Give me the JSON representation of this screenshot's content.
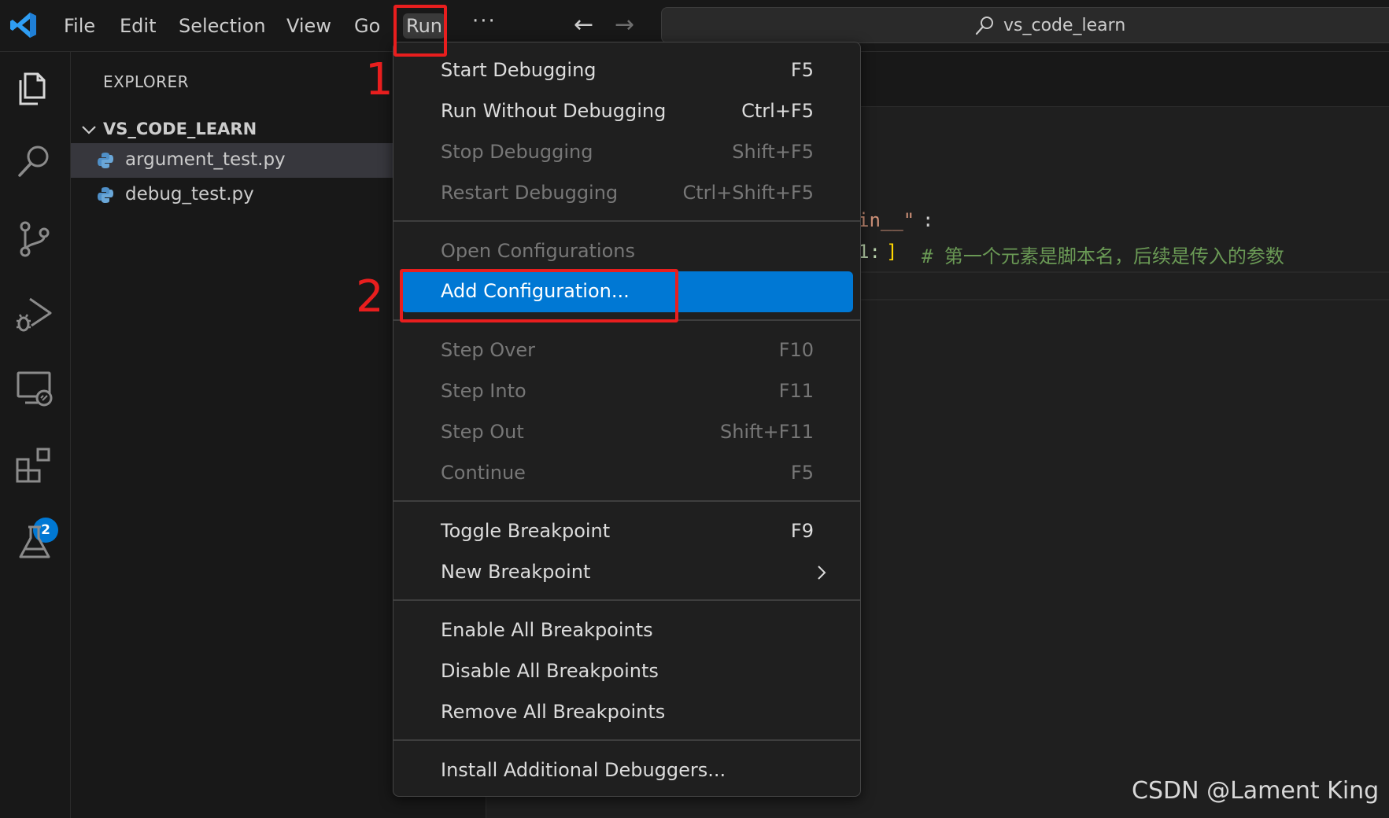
{
  "menubar": {
    "items": [
      "File",
      "Edit",
      "Selection",
      "View",
      "Go",
      "Run"
    ],
    "more": "···",
    "back_arrow": "←",
    "forward_arrow": "→"
  },
  "search": {
    "text": "vs_code_learn",
    "icon": "search-icon"
  },
  "activity_bar": {
    "icons": [
      "explorer-icon",
      "search-icon",
      "source-control-icon",
      "run-debug-icon",
      "remote-explorer-icon",
      "extensions-icon",
      "testing-icon"
    ],
    "extensions_badge": "2"
  },
  "sidebar": {
    "title": "EXPLORER",
    "folder": "VS_CODE_LEARN",
    "files": [
      "argument_test.py",
      "debug_test.py"
    ]
  },
  "editor": {
    "line1_string": "in__\"",
    "line1_colon": ":",
    "line2_code": "1:",
    "line2_bracket": "]",
    "line2_comment": "# 第一个元素是脚本名，后续是传入的参数"
  },
  "run_menu": {
    "groups": [
      [
        {
          "label": "Start Debugging",
          "key": "F5",
          "enabled": true
        },
        {
          "label": "Run Without Debugging",
          "key": "Ctrl+F5",
          "enabled": true
        },
        {
          "label": "Stop Debugging",
          "key": "Shift+F5",
          "enabled": false
        },
        {
          "label": "Restart Debugging",
          "key": "Ctrl+Shift+F5",
          "enabled": false
        }
      ],
      [
        {
          "label": "Open Configurations",
          "key": "",
          "enabled": false
        },
        {
          "label": "Add Configuration...",
          "key": "",
          "enabled": true,
          "active": true
        }
      ],
      [
        {
          "label": "Step Over",
          "key": "F10",
          "enabled": false
        },
        {
          "label": "Step Into",
          "key": "F11",
          "enabled": false
        },
        {
          "label": "Step Out",
          "key": "Shift+F11",
          "enabled": false
        },
        {
          "label": "Continue",
          "key": "F5",
          "enabled": false
        }
      ],
      [
        {
          "label": "Toggle Breakpoint",
          "key": "F9",
          "enabled": true
        },
        {
          "label": "New Breakpoint",
          "key": "",
          "enabled": true,
          "submenu": true
        }
      ],
      [
        {
          "label": "Enable All Breakpoints",
          "key": "",
          "enabled": true
        },
        {
          "label": "Disable All Breakpoints",
          "key": "",
          "enabled": true
        },
        {
          "label": "Remove All Breakpoints",
          "key": "",
          "enabled": true
        }
      ],
      [
        {
          "label": "Install Additional Debuggers...",
          "key": "",
          "enabled": true
        }
      ]
    ]
  },
  "annotations": {
    "step1": "1",
    "step2": "2",
    "color": "#e81e1e"
  },
  "watermark": "CSDN @Lament King"
}
